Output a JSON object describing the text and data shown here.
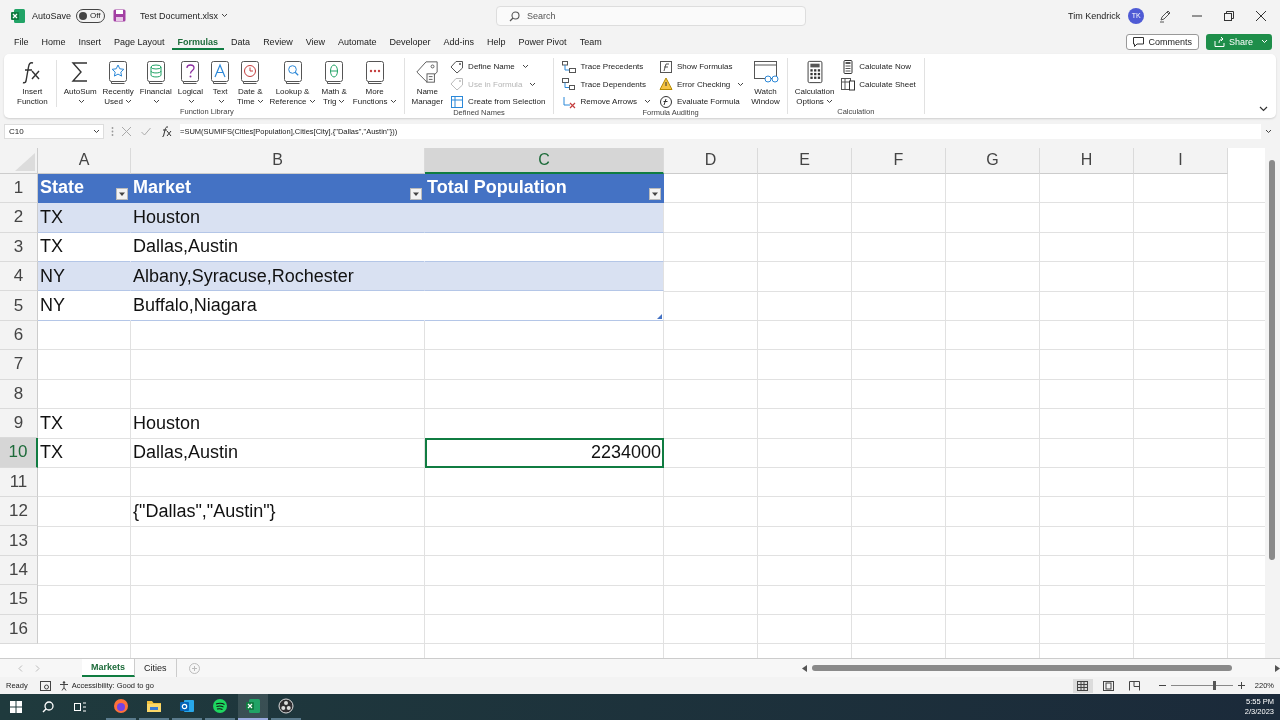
{
  "title_bar": {
    "autosave_label": "AutoSave",
    "autosave_toggle": {
      "label": "Off",
      "on": false
    },
    "document_title": "Test Document.xlsx",
    "search_placeholder": "Search",
    "user_name": "Tim Kendrick",
    "user_initials": "TK"
  },
  "menu_tabs": [
    {
      "label": "File",
      "selected": false
    },
    {
      "label": "Home",
      "selected": false
    },
    {
      "label": "Insert",
      "selected": false
    },
    {
      "label": "Page Layout",
      "selected": false
    },
    {
      "label": "Formulas",
      "selected": true
    },
    {
      "label": "Data",
      "selected": false
    },
    {
      "label": "Review",
      "selected": false
    },
    {
      "label": "View",
      "selected": false
    },
    {
      "label": "Automate",
      "selected": false
    },
    {
      "label": "Developer",
      "selected": false
    },
    {
      "label": "Add-ins",
      "selected": false
    },
    {
      "label": "Help",
      "selected": false
    },
    {
      "label": "Power Pivot",
      "selected": false
    },
    {
      "label": "Team",
      "selected": false
    }
  ],
  "comments_button": "Comments",
  "share_button": "Share",
  "ribbon_groups": [
    {
      "label": "Function Library",
      "items": [
        {
          "kind": "large",
          "lines": [
            "Insert",
            "Function"
          ],
          "dropdown": false
        },
        {
          "kind": "large",
          "lines": [
            "AutoSum"
          ],
          "dropdown": true
        },
        {
          "kind": "large",
          "lines": [
            "Recently",
            "Used"
          ],
          "dropdown": true
        },
        {
          "kind": "large",
          "lines": [
            "Financial"
          ],
          "dropdown": true
        },
        {
          "kind": "large",
          "lines": [
            "Logical"
          ],
          "dropdown": true
        },
        {
          "kind": "large",
          "lines": [
            "Text"
          ],
          "dropdown": true
        },
        {
          "kind": "large",
          "lines": [
            "Date &",
            "Time"
          ],
          "dropdown": true
        },
        {
          "kind": "large",
          "lines": [
            "Lookup &",
            "Reference"
          ],
          "dropdown": true
        },
        {
          "kind": "large",
          "lines": [
            "Math &",
            "Trig"
          ],
          "dropdown": true
        },
        {
          "kind": "large",
          "lines": [
            "More",
            "Functions"
          ],
          "dropdown": true
        }
      ]
    },
    {
      "label": "Defined Names",
      "items": [
        {
          "kind": "large",
          "lines": [
            "Name",
            "Manager"
          ],
          "dropdown": false
        },
        {
          "kind": "stack",
          "items": [
            {
              "label": "Define Name",
              "dropdown": true,
              "disabled": false
            },
            {
              "label": "Use in Formula",
              "dropdown": true,
              "disabled": true
            },
            {
              "label": "Create from Selection",
              "dropdown": false,
              "disabled": false
            }
          ]
        }
      ]
    },
    {
      "label": "Formula Auditing",
      "items": [
        {
          "kind": "stack",
          "items": [
            {
              "label": "Trace Precedents",
              "dropdown": false,
              "disabled": false
            },
            {
              "label": "Trace Dependents",
              "dropdown": false,
              "disabled": false
            },
            {
              "label": "Remove Arrows",
              "dropdown": true,
              "disabled": false
            }
          ]
        },
        {
          "kind": "stack",
          "items": [
            {
              "label": "Show Formulas",
              "dropdown": false,
              "disabled": false
            },
            {
              "label": "Error Checking",
              "dropdown": true,
              "disabled": false
            },
            {
              "label": "Evaluate Formula",
              "dropdown": false,
              "disabled": false
            }
          ]
        },
        {
          "kind": "large",
          "lines": [
            "Watch",
            "Window"
          ],
          "dropdown": false
        }
      ]
    },
    {
      "label": "Calculation",
      "items": [
        {
          "kind": "large",
          "lines": [
            "Calculation",
            "Options"
          ],
          "dropdown": true
        },
        {
          "kind": "stack",
          "items": [
            {
              "label": "Calculate Now",
              "dropdown": false,
              "disabled": false
            },
            {
              "label": "Calculate Sheet",
              "dropdown": false,
              "disabled": false
            }
          ]
        }
      ]
    }
  ],
  "formula_bar": {
    "name_box": "C10",
    "formula": "=SUM(SUMIFS(Cities[Population],Cities[City],{\"Dallas\",\"Austin\"}))"
  },
  "columns": [
    {
      "label": "A",
      "selected": false
    },
    {
      "label": "B",
      "selected": false
    },
    {
      "label": "C",
      "selected": true
    },
    {
      "label": "D",
      "selected": false
    },
    {
      "label": "E",
      "selected": false
    },
    {
      "label": "F",
      "selected": false
    },
    {
      "label": "G",
      "selected": false
    },
    {
      "label": "H",
      "selected": false
    },
    {
      "label": "I",
      "selected": false
    }
  ],
  "rows": [
    {
      "number": "1",
      "selected": false,
      "kind": "table-header",
      "cells": {
        "column_a": {
          "text": "State",
          "kind": "text"
        },
        "column_b": {
          "text": "Market",
          "kind": "text"
        },
        "column_c": {
          "text": "Total Population",
          "kind": "text"
        }
      }
    },
    {
      "number": "2",
      "selected": false,
      "kind": "table-band",
      "cells": {
        "column_a": {
          "text": "TX",
          "kind": "text"
        },
        "column_b": {
          "text": "Houston",
          "kind": "text"
        }
      }
    },
    {
      "number": "3",
      "selected": false,
      "kind": "table-row",
      "cells": {
        "column_a": {
          "text": "TX",
          "kind": "text"
        },
        "column_b": {
          "text": "Dallas,Austin",
          "kind": "text"
        }
      }
    },
    {
      "number": "4",
      "selected": false,
      "kind": "table-band",
      "cells": {
        "column_a": {
          "text": "NY",
          "kind": "text"
        },
        "column_b": {
          "text": "Albany,Syracuse,Rochester",
          "kind": "text"
        }
      }
    },
    {
      "number": "5",
      "selected": false,
      "kind": "table-last",
      "cells": {
        "column_a": {
          "text": "NY",
          "kind": "text"
        },
        "column_b": {
          "text": "Buffalo,Niagara",
          "kind": "text"
        }
      }
    },
    {
      "number": "6",
      "selected": false,
      "kind": "plain"
    },
    {
      "number": "7",
      "selected": false,
      "kind": "plain"
    },
    {
      "number": "8",
      "selected": false,
      "kind": "plain"
    },
    {
      "number": "9",
      "selected": false,
      "kind": "plain",
      "cells": {
        "column_a": {
          "text": "TX",
          "kind": "text"
        },
        "column_b": {
          "text": "Houston",
          "kind": "text"
        }
      }
    },
    {
      "number": "10",
      "selected": true,
      "kind": "plain",
      "cells": {
        "column_a": {
          "text": "TX",
          "kind": "text"
        },
        "column_b": {
          "text": "Dallas,Austin",
          "kind": "text"
        },
        "column_c": {
          "text": "2234000",
          "kind": "number"
        }
      }
    },
    {
      "number": "11",
      "selected": false,
      "kind": "plain"
    },
    {
      "number": "12",
      "selected": false,
      "kind": "plain",
      "cells": {
        "column_b": {
          "text": "{\"Dallas\",\"Austin\"}",
          "kind": "text"
        }
      }
    },
    {
      "number": "13",
      "selected": false,
      "kind": "plain"
    },
    {
      "number": "14",
      "selected": false,
      "kind": "plain"
    },
    {
      "number": "15",
      "selected": false,
      "kind": "plain"
    },
    {
      "number": "16",
      "selected": false,
      "kind": "plain"
    }
  ],
  "sheet_tabs": [
    {
      "label": "Markets",
      "selected": true
    },
    {
      "label": "Cities",
      "selected": false
    }
  ],
  "status_bar": {
    "status": "Ready",
    "accessibility": "Accessibility: Good to go",
    "view_buttons": [
      {
        "selected": true
      },
      {
        "selected": false
      },
      {
        "selected": false
      }
    ],
    "zoom_slider": {
      "level": 0.7
    },
    "zoom": "220%"
  },
  "taskbar": {
    "apps": [
      {
        "kind": "browser",
        "selected": false
      },
      {
        "kind": "folder",
        "selected": false
      },
      {
        "kind": "mail",
        "selected": false
      },
      {
        "kind": "music",
        "selected": false
      },
      {
        "kind": "spreadsheet",
        "selected": true
      },
      {
        "kind": "recorder",
        "selected": false
      }
    ],
    "time": "5:55 PM",
    "date": "2/3/2023"
  }
}
